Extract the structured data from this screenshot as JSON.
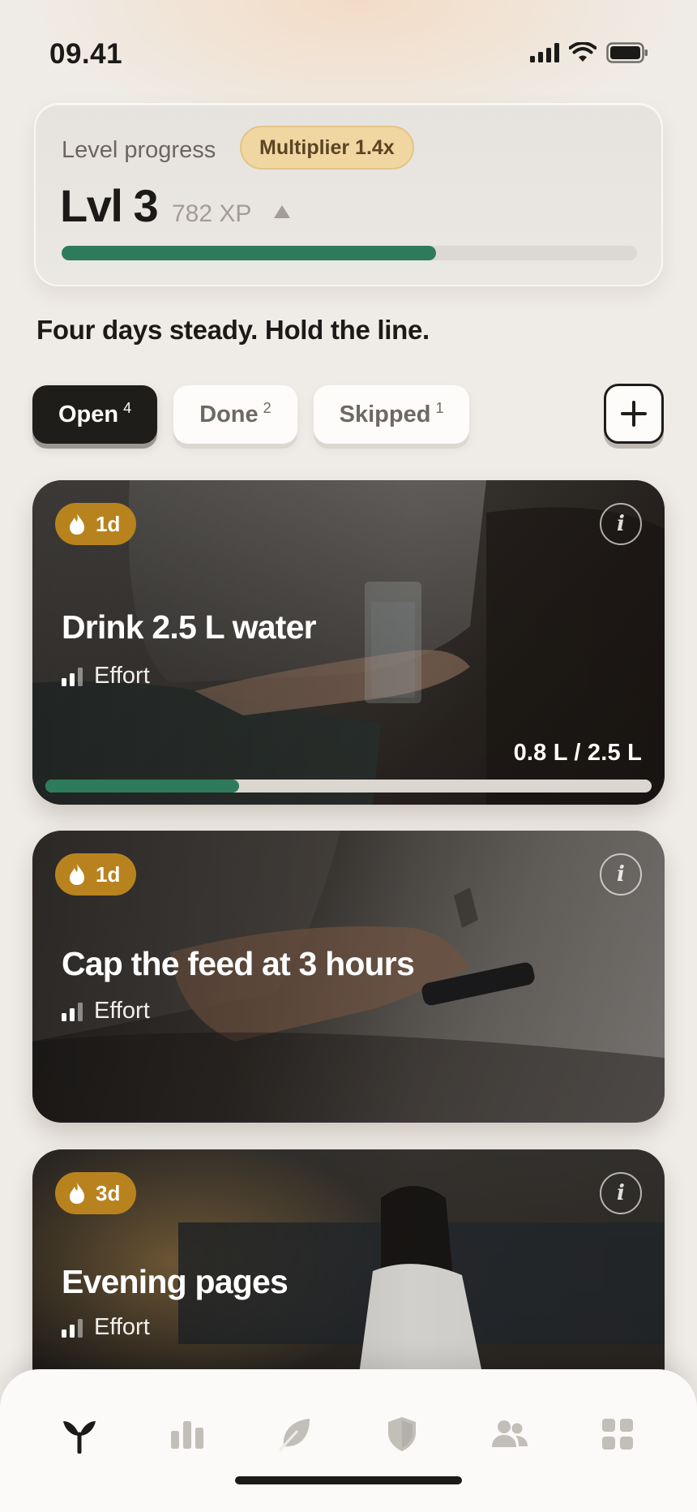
{
  "status_bar": {
    "time": "09.41"
  },
  "level_card": {
    "label": "Level progress",
    "multiplier": "Multiplier 1.4x",
    "level": "Lvl 3",
    "xp": "782 XP",
    "progress_fraction": 0.65,
    "progress_color": "#2e7a5c"
  },
  "tagline": "Four days steady. Hold the line.",
  "filters": [
    {
      "label": "Open",
      "count": "4",
      "active": true
    },
    {
      "label": "Done",
      "count": "2",
      "active": false
    },
    {
      "label": "Skipped",
      "count": "1",
      "active": false
    }
  ],
  "habits": [
    {
      "streak": "1d",
      "title": "Drink 2.5 L water",
      "effort": "Effort",
      "progress_text": "0.8 L / 2.5 L",
      "progress_fraction": 0.32
    },
    {
      "streak": "1d",
      "title": "Cap the feed at 3 hours",
      "effort": "Effort"
    },
    {
      "streak": "3d",
      "title": "Evening pages",
      "effort": "Effort"
    }
  ],
  "nav": {
    "items": [
      "sprout-icon",
      "chart-icon",
      "leaf-icon",
      "shield-icon",
      "people-icon",
      "grid-icon"
    ],
    "active": "sprout-icon",
    "active_color": "#1b1a18",
    "inactive_color": "#c2beb8"
  },
  "accent_colors": {
    "streak": "#b8831e",
    "progress": "#2e7a5c",
    "badge": "#f0d7a2"
  }
}
